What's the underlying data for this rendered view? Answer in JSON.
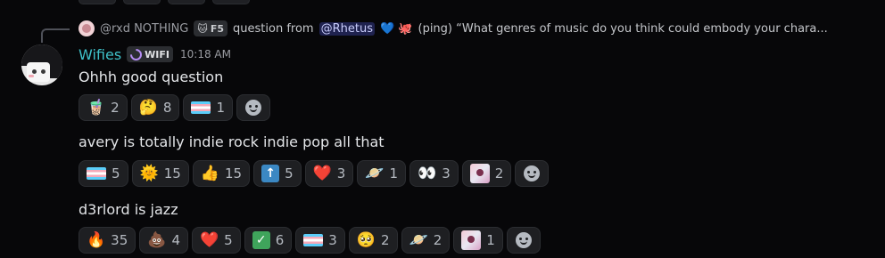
{
  "reply": {
    "author": "@rxd NOTHING",
    "author_tag": "F5",
    "author_tag_icon": "cat-icon",
    "lead_text": "question from",
    "mention": "@Rhetus",
    "mention_emojis": "💙 🐙",
    "snippet": "(ping) “What genres of music do you think could embody your chara..."
  },
  "message": {
    "username": "Wifies",
    "username_color": "#3fc1c9",
    "guild_tag": "WIFI",
    "timestamp": "10:18 AM"
  },
  "messages": [
    {
      "text": "Ohhh good question",
      "reactions": [
        {
          "emoji": "🧋",
          "count": "2"
        },
        {
          "emoji": "🤔",
          "count": "8"
        },
        {
          "emoji": "trans-flag",
          "count": "1"
        }
      ]
    },
    {
      "text": "avery is totally indie rock indie pop all that",
      "reactions": [
        {
          "emoji": "trans-flag",
          "count": "5"
        },
        {
          "emoji": "🌞",
          "count": "15"
        },
        {
          "emoji": "👍",
          "count": "15"
        },
        {
          "emoji": "up-arrow",
          "count": "5"
        },
        {
          "emoji": "❤️",
          "count": "3"
        },
        {
          "emoji": "🪐",
          "count": "1"
        },
        {
          "emoji": "👀",
          "count": "3"
        },
        {
          "emoji": "custom-sticker",
          "count": "2"
        }
      ]
    },
    {
      "text": "d3rlord is jazz",
      "reactions": [
        {
          "emoji": "🔥",
          "count": "35"
        },
        {
          "emoji": "💩",
          "count": "4"
        },
        {
          "emoji": "❤️",
          "count": "5"
        },
        {
          "emoji": "check-mark",
          "count": "6"
        },
        {
          "emoji": "trans-flag",
          "count": "3"
        },
        {
          "emoji": "🥺",
          "count": "2"
        },
        {
          "emoji": "🪐",
          "count": "2"
        },
        {
          "emoji": "custom-sticker",
          "count": "1"
        }
      ]
    }
  ]
}
